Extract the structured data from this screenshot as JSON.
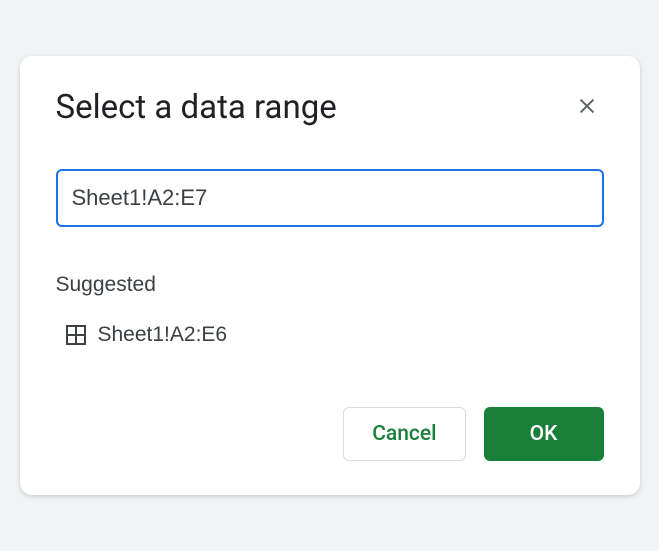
{
  "dialog": {
    "title": "Select a data range",
    "input_value": "Sheet1!A2:E7",
    "suggested_label": "Suggested",
    "suggestions": [
      {
        "label": "Sheet1!A2:E6"
      }
    ],
    "buttons": {
      "cancel": "Cancel",
      "ok": "OK"
    }
  }
}
